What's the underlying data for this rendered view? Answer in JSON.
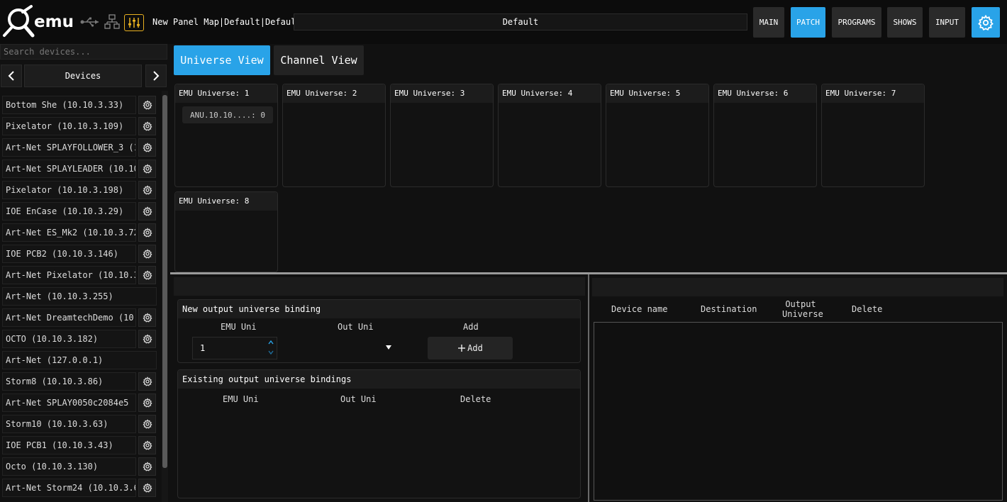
{
  "header": {
    "panel_title": "New Panel Map|Default|Default",
    "preset": "Default",
    "nav": [
      {
        "label": "MAIN",
        "active": false
      },
      {
        "label": "PATCH",
        "active": true
      },
      {
        "label": "PROGRAMS",
        "active": false
      },
      {
        "label": "SHOWS",
        "active": false
      },
      {
        "label": "INPUT",
        "active": false
      }
    ],
    "accent_color": "#29a3e8",
    "icons": [
      "emu-logo",
      "usb-icon",
      "network-icon",
      "mixer-icon",
      "settings-gear-icon"
    ]
  },
  "sidebar": {
    "search_placeholder": "Search devices...",
    "title": "Devices",
    "devices": [
      {
        "name": "Bottom She (10.10.3.33)",
        "gear": true
      },
      {
        "name": "Pixelator  (10.10.3.109)",
        "gear": true
      },
      {
        "name": "Art-Net SPLAYFOLLOWER_3 (1",
        "gear": true
      },
      {
        "name": "Art-Net SPLAYLEADER (10.10",
        "gear": true
      },
      {
        "name": "Pixelator  (10.10.3.198)",
        "gear": true
      },
      {
        "name": "IOE EnCase (10.10.3.29)",
        "gear": true
      },
      {
        "name": "Art-Net ES_Mk2 (10.10.3.72",
        "gear": true
      },
      {
        "name": "IOE PCB2 (10.10.3.146)",
        "gear": true
      },
      {
        "name": "Art-Net Pixelator (10.10.3",
        "gear": true
      },
      {
        "name": "Art-Net (10.10.3.255)",
        "gear": false
      },
      {
        "name": "Art-Net DreamtechDemo (10.",
        "gear": true
      },
      {
        "name": "OCTO (10.10.3.182)",
        "gear": true
      },
      {
        "name": "Art-Net (127.0.0.1)",
        "gear": false
      },
      {
        "name": "Storm8 (10.10.3.86)",
        "gear": true
      },
      {
        "name": "Art-Net SPLAY0050c2084e5 (",
        "gear": true
      },
      {
        "name": "Storm10 (10.10.3.63)",
        "gear": true
      },
      {
        "name": "IOE PCB1 (10.10.3.43)",
        "gear": true
      },
      {
        "name": "Octo (10.10.3.130)",
        "gear": true
      },
      {
        "name": "Art-Net Storm24 (10.10.3.6",
        "gear": true
      }
    ]
  },
  "view": {
    "universe_view": "Universe View",
    "channel_view": "Channel View",
    "active": "Universe View"
  },
  "universes": [
    {
      "label": "EMU Universe: 1",
      "chip": "ANU.10.10....: 0"
    },
    {
      "label": "EMU Universe: 2",
      "chip": null
    },
    {
      "label": "EMU Universe: 3",
      "chip": null
    },
    {
      "label": "EMU Universe: 4",
      "chip": null
    },
    {
      "label": "EMU Universe: 5",
      "chip": null
    },
    {
      "label": "EMU Universe: 6",
      "chip": null
    },
    {
      "label": "EMU Universe: 7",
      "chip": null
    },
    {
      "label": "EMU Universe: 8",
      "chip": null
    }
  ],
  "new_binding": {
    "title": "New output universe binding",
    "col_emu_uni": "EMU Uni",
    "col_out_uni": "Out Uni",
    "col_add": "Add",
    "emu_uni_value": "1",
    "add_button": "Add"
  },
  "existing_bindings": {
    "title": "Existing output universe bindings",
    "col_emu_uni": "EMU Uni",
    "col_out_uni": "Out Uni",
    "col_delete": "Delete"
  },
  "device_table": {
    "col_device_name": "Device name",
    "col_destination": "Destination",
    "col_output_universe_1": "Output",
    "col_output_universe_2": "Universe",
    "col_delete": "Delete"
  }
}
